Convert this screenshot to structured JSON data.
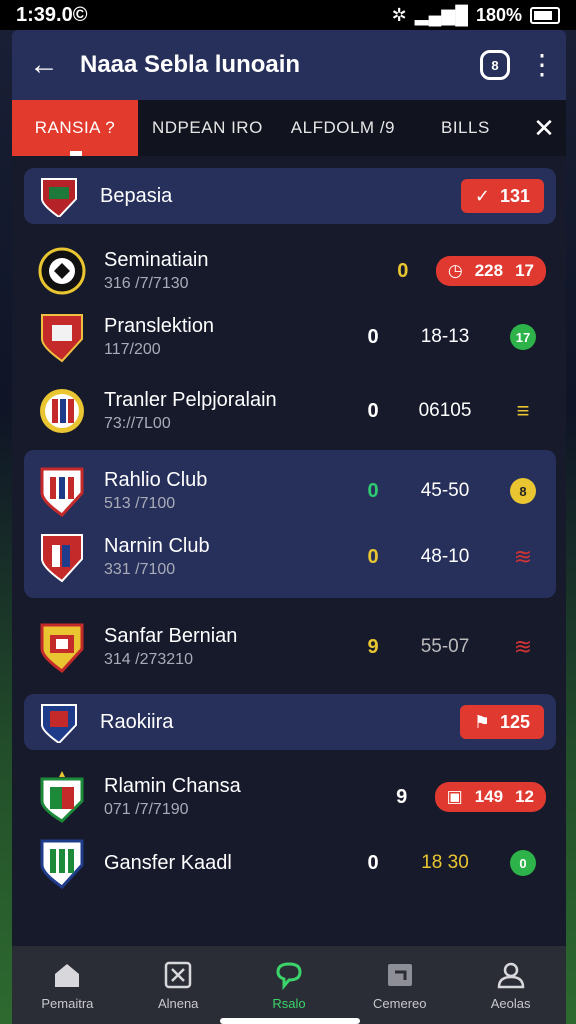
{
  "status": {
    "time": "1:39.0©",
    "battery": "180%"
  },
  "header": {
    "title": "Naaa Sebla lunoain",
    "badge": "8"
  },
  "tabs": [
    {
      "label": "RANSIA ?"
    },
    {
      "label": "NDPEAN IRO"
    },
    {
      "label": "ALFDOLM /9"
    },
    {
      "label": "BILLS"
    }
  ],
  "sections": [
    {
      "name": "Bepasia",
      "pill": "131",
      "rows": [
        {
          "team": "Seminatiain",
          "record": "316 /7/7130",
          "score": "0",
          "score_color": "#e8c531",
          "pill_left": "228",
          "pill_right": "17"
        },
        {
          "team": "Pranslektion",
          "record": "117/200",
          "score": "0",
          "score_color": "#ffffff",
          "odds": "18-13",
          "ind_text": "17",
          "ind_color": "#2db34a"
        },
        {
          "team": "Tranler Pelpjoralain",
          "record": "73://7L00",
          "score": "0",
          "score_color": "#ffffff",
          "odds": "06105",
          "ind_color": "#e8c531"
        }
      ],
      "highlight": [
        {
          "team": "Rahlio Club",
          "record": "513 /7100",
          "score": "0",
          "score_color": "#2ecc71",
          "odds": "45-50",
          "ind_text": "8",
          "ind_color": "#e8c531"
        },
        {
          "team": "Narnin Club",
          "record": "331 /7100",
          "score": "0",
          "score_color": "#e8c531",
          "odds": "48-10",
          "ind_color": "#d23434"
        }
      ],
      "tail": [
        {
          "team": "Sanfar Bernian",
          "record": "314 /273210",
          "score": "9",
          "score_color": "#e8c531",
          "odds": "55-07",
          "ind_color": "#d23434"
        }
      ]
    },
    {
      "name": "Raokiira",
      "pill": "125",
      "rows": [
        {
          "team": "Rlamin Chansa",
          "record": "071 /7/7190",
          "score": "9",
          "score_color": "#ffffff",
          "pill_left": "149",
          "pill_right": "12"
        },
        {
          "team": "Gansfer Kaadl",
          "record": "",
          "score": "0",
          "score_color": "#ffffff",
          "odds": "18 30",
          "ind_text": "0",
          "ind_color": "#2db34a"
        }
      ]
    }
  ],
  "nav": [
    {
      "label": "Pemaitra",
      "icon": "home-icon"
    },
    {
      "label": "Alnena",
      "icon": "edit-icon"
    },
    {
      "label": "Rsalo",
      "icon": "chat-icon"
    },
    {
      "label": "Cemereo",
      "icon": "calendar-icon"
    },
    {
      "label": "Aeolas",
      "icon": "profile-icon"
    }
  ]
}
